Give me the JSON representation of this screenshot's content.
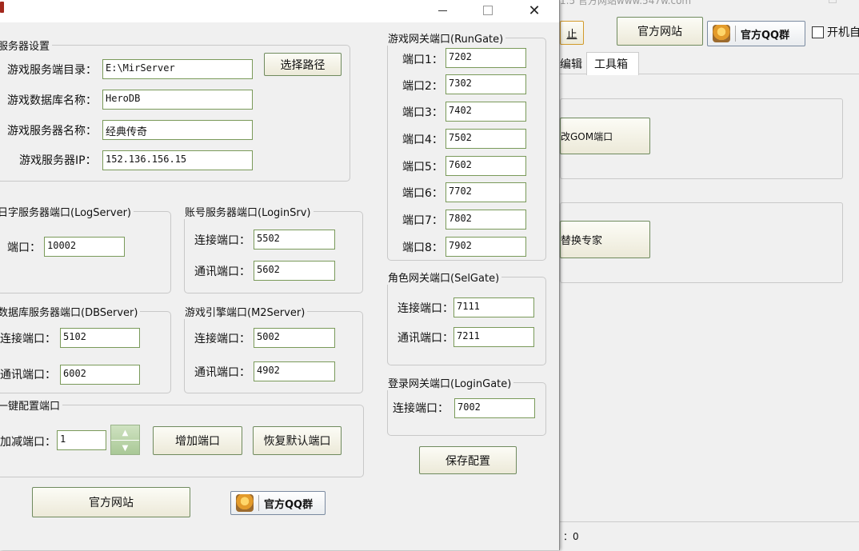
{
  "background_window": {
    "title_fragment": "1.5 官方网站www.547w.com",
    "buttons": {
      "stop_fragment": "止",
      "official_site": "官方网站",
      "qq_group": "官方QQ群"
    },
    "autostart_label": "开机自",
    "tabs": [
      "编辑",
      "工具箱"
    ],
    "gom_port_button_fragment": "改GOM端口",
    "replace_expert_fragment": "替换专家",
    "status_fragment": "：0"
  },
  "dialog": {
    "window_controls": {
      "minimize": "–",
      "maximize": "□",
      "close": "✕"
    },
    "server_settings": {
      "legend": "服务器设置",
      "dir_label": "游戏服务端目录：",
      "dir_value": "E:\\MirServer",
      "choose_path_button": "选择路径",
      "db_name_label": "游戏数据库名称：",
      "db_name_value": "HeroDB",
      "server_name_label": "游戏服务器名称：",
      "server_name_value": "经典传奇",
      "ip_label": "游戏服务器IP：",
      "ip_value": "152.136.156.15"
    },
    "log_server": {
      "legend": "日字服务器端口(LogServer)",
      "port_label": "端口：",
      "port_value": "10002"
    },
    "login_srv": {
      "legend": "账号服务器端口(LoginSrv)",
      "connect_label": "连接端口：",
      "connect_value": "5502",
      "comm_label": "通讯端口：",
      "comm_value": "5602"
    },
    "db_server": {
      "legend": "数据库服务器端口(DBServer)",
      "connect_label": "连接端口：",
      "connect_value": "5102",
      "comm_label": "通讯端口：",
      "comm_value": "6002"
    },
    "m2_server": {
      "legend": "游戏引擎端口(M2Server)",
      "connect_label": "连接端口：",
      "connect_value": "5002",
      "comm_label": "通讯端口：",
      "comm_value": "4902"
    },
    "one_click": {
      "legend": "一键配置端口",
      "step_label": "加减端口：",
      "step_value": "1",
      "add_port_button": "增加端口",
      "restore_button": "恢复默认端口"
    },
    "run_gate": {
      "legend": "游戏网关端口(RunGate)",
      "ports": [
        {
          "label": "端口1：",
          "value": "7202"
        },
        {
          "label": "端口2：",
          "value": "7302"
        },
        {
          "label": "端口3：",
          "value": "7402"
        },
        {
          "label": "端口4：",
          "value": "7502"
        },
        {
          "label": "端口5：",
          "value": "7602"
        },
        {
          "label": "端口6：",
          "value": "7702"
        },
        {
          "label": "端口7：",
          "value": "7802"
        },
        {
          "label": "端口8：",
          "value": "7902"
        }
      ]
    },
    "sel_gate": {
      "legend": "角色网关端口(SelGate)",
      "connect_label": "连接端口：",
      "connect_value": "7111",
      "comm_label": "通讯端口：",
      "comm_value": "7211"
    },
    "login_gate": {
      "legend": "登录网关端口(LoginGate)",
      "connect_label": "连接端口：",
      "connect_value": "7002"
    },
    "save_button": "保存配置",
    "official_site_button": "官方网站",
    "qq_group_button": "官方QQ群"
  }
}
